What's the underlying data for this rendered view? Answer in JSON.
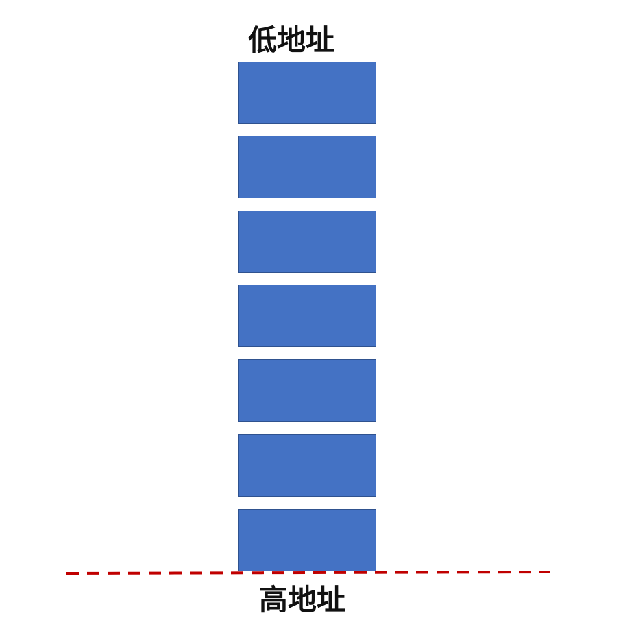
{
  "labels": {
    "top": "低地址",
    "bottom": "高地址"
  },
  "stack": {
    "block_count": 7,
    "block_color": "#4472c4",
    "block_border_color": "#2f528f"
  },
  "baseline": {
    "style": "dashed",
    "color": "#c00000"
  }
}
